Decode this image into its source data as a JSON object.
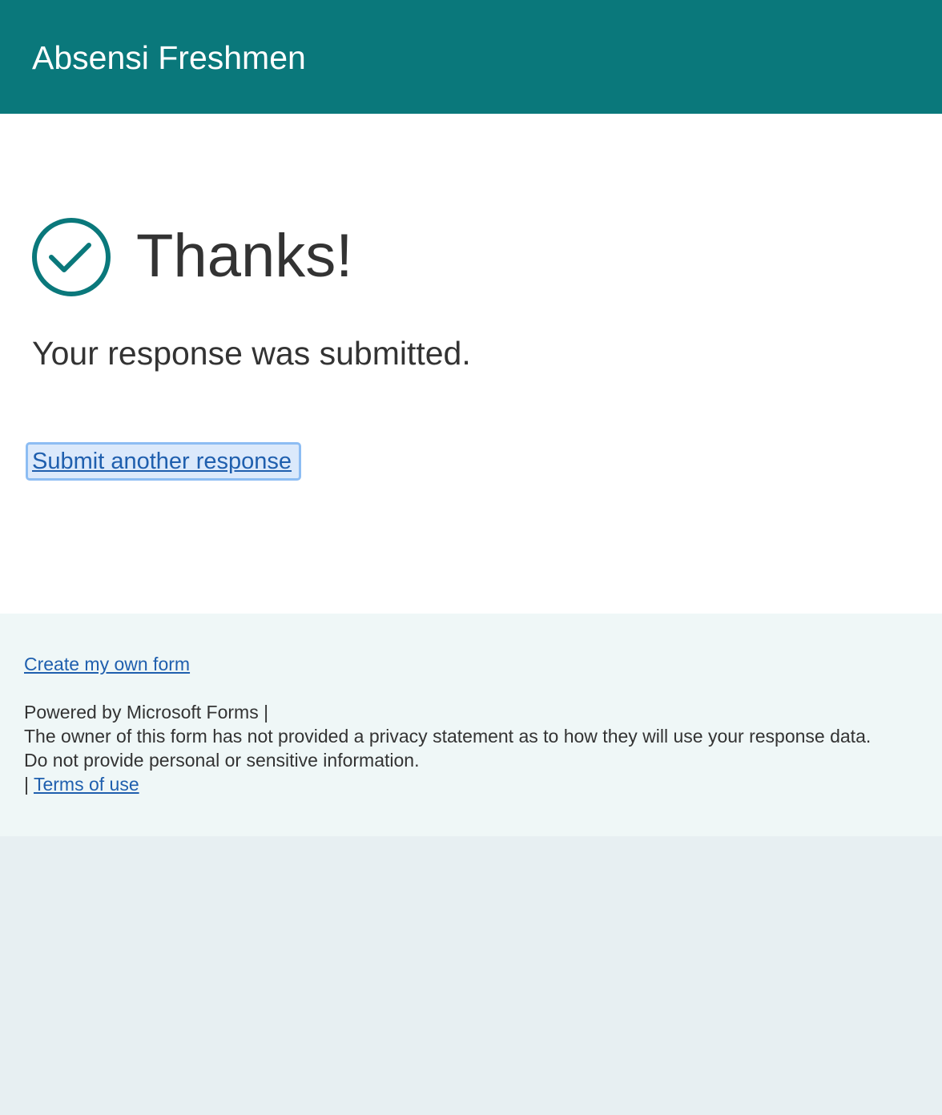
{
  "header": {
    "title": "Absensi Freshmen",
    "background_color": "#0a787b"
  },
  "confirmation": {
    "icon": "check-circle-icon",
    "icon_color": "#0a787b",
    "heading": "Thanks!",
    "message": "Your response was submitted.",
    "submit_another_label": "Submit another response"
  },
  "footer": {
    "create_form_label": "Create my own form",
    "powered_by": "Powered by Microsoft Forms |",
    "privacy_notice": "The owner of this form has not provided a privacy statement as to how they will use your response data.",
    "sensitive_notice": "Do not provide personal or sensitive information.",
    "terms_separator": "|",
    "terms_label": "Terms of use",
    "link_color": "#1f5fae"
  }
}
